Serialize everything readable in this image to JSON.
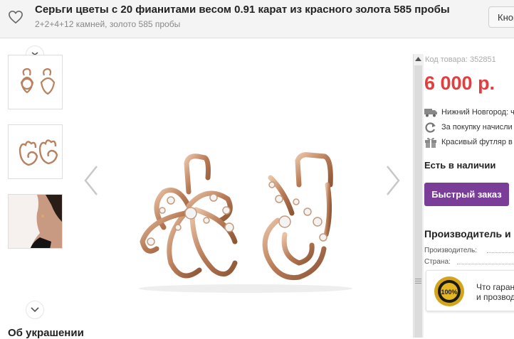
{
  "header": {
    "title": "Серьги цветы с 20 фианитами весом 0.91 карат из красного золота 585 пробы",
    "subtitle": "2+2+4+12 камней, золото 585 пробы",
    "button_label": "Кнопка"
  },
  "gallery": {
    "section_title": "Об украшении"
  },
  "product": {
    "sku_text": "Код товара: 352851",
    "price": "6 000 р.",
    "delivery": "Нижний Новгород: ч",
    "bonus": "За покупку начисли",
    "gift_box": "Красивый футляр в",
    "availability": "Есть в наличии",
    "quick_order_label": "Быстрый заказ"
  },
  "manufacturer": {
    "title": "Производитель и",
    "maker_label": "Производитель:",
    "country_label": "Страна:",
    "guarantee_line1": "Что гаран",
    "guarantee_line2": "и прозвод",
    "seal_text": "100%"
  },
  "colors": {
    "price": "#e43d3d",
    "button": "#7a3d98",
    "gold": "#c58f6d"
  }
}
